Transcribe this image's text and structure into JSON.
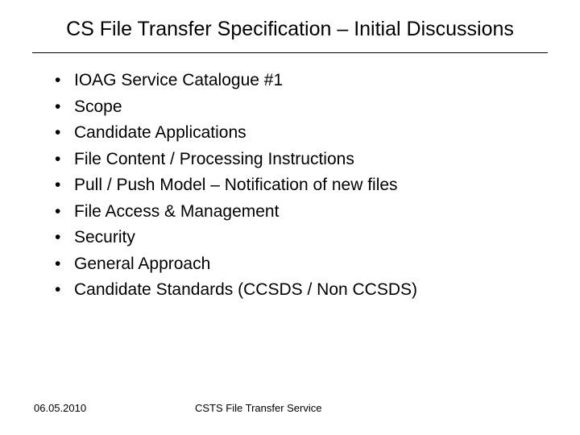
{
  "title": "CS File Transfer Specification – Initial Discussions",
  "bullets": [
    "IOAG Service Catalogue #1",
    "Scope",
    "Candidate Applications",
    "File Content / Processing Instructions",
    "Pull / Push Model – Notification of new files",
    "File Access & Management",
    "Security",
    "General Approach",
    "Candidate Standards (CCSDS / Non CCSDS)"
  ],
  "footer": {
    "date": "06.05.2010",
    "service": "CSTS File Transfer Service"
  }
}
